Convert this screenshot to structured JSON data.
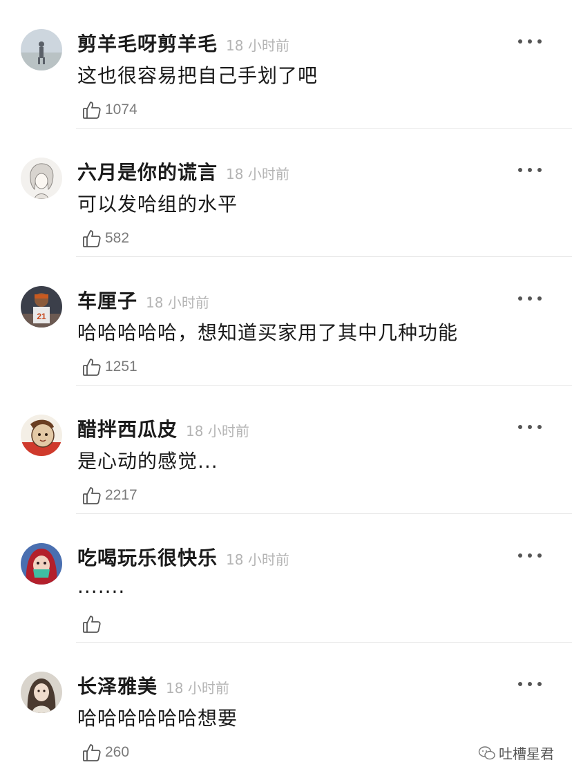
{
  "comments": [
    {
      "username": "剪羊毛呀剪羊毛",
      "time": "18 小时前",
      "text": "这也很容易把自己手划了吧",
      "likes": "1074"
    },
    {
      "username": "六月是你的谎言",
      "time": "18 小时前",
      "text": "可以发哈组的水平",
      "likes": "582"
    },
    {
      "username": "车厘子",
      "time": "18 小时前",
      "text": "哈哈哈哈哈，想知道买家用了其中几种功能",
      "likes": "1251"
    },
    {
      "username": "醋拌西瓜皮",
      "time": "18 小时前",
      "text": "是心动的感觉...",
      "likes": "2217"
    },
    {
      "username": "吃喝玩乐很快乐",
      "time": "18 小时前",
      "text": ".......",
      "likes": ""
    },
    {
      "username": "长泽雅美",
      "time": "18 小时前",
      "text": "哈哈哈哈哈哈想要",
      "likes": "260"
    }
  ],
  "watermark": {
    "text": "吐槽星君"
  },
  "icons": {
    "like": "thumbs-up-icon",
    "more": "more-dots-icon",
    "watermark": "wechat-icon"
  },
  "colors": {
    "text": "#1a1a1a",
    "time": "#b4b4b4",
    "like_count": "#7a7a7a",
    "divider": "#e6e6e6"
  }
}
